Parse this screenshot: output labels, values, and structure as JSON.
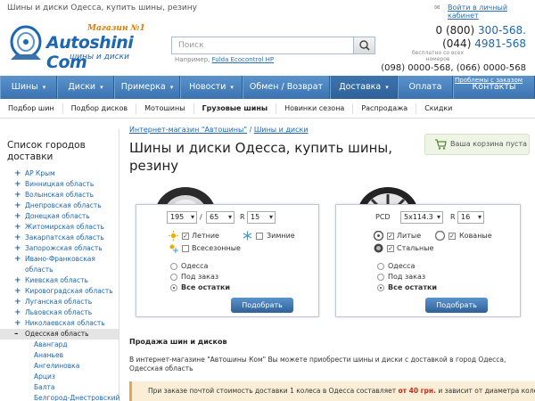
{
  "page": {
    "title": "Шины и диски Одесса, купить шины, резину",
    "login_link": "Войти в личный кабинет"
  },
  "header": {
    "logo_tag": "Магазин №1",
    "logo_name": "Autoshini Com",
    "logo_sub": "шины и диски",
    "search_placeholder": "Поиск",
    "search_hint_prefix": "Например,",
    "search_hint_example": "Fulda Ecocontrol HP",
    "phone1_prefix": "0 (800)",
    "phone1_number": "300-568.",
    "phone2_prefix": "(044)",
    "phone2_number": "4981-568",
    "free_note": "бесплатно со всех номеров",
    "phones_extra": "(098) 0000-568, (066) 0000-568"
  },
  "nav": {
    "items": [
      "Шины",
      "Диски",
      "Примерка",
      "Новости",
      "Обмен / Возврат",
      "Доставка",
      "Оплата",
      "Контакты"
    ],
    "problem_link": "Проблемы с заказом"
  },
  "subnav": {
    "items": [
      "Подбор шин",
      "Подбор дисков",
      "Мотошины",
      "Грузовые шины",
      "Новинки сезона",
      "Распродажа",
      "Скидки"
    ]
  },
  "sidebar": {
    "heading": "Список городов доставки",
    "regions": [
      "АР Крым",
      "Винницкая область",
      "Волынская область",
      "Днепровская область",
      "Донецкая область",
      "Житомирская область",
      "Закарпатская область",
      "Запорожская область",
      "Ивано-Франковская область",
      "Киевская область",
      "Кировоградская область",
      "Луганская область",
      "Львовская область",
      "Николаевская область",
      "Одесская область"
    ],
    "cities": [
      "Авангард",
      "Ананьев",
      "Ангелиновка",
      "Арциз",
      "Балта",
      "Белгород-Днестровский"
    ]
  },
  "content": {
    "breadcrumb_home": "Интернет-магазин \"Автошины\"",
    "breadcrumb_sep": "/",
    "breadcrumb_current": "Шины и диски",
    "heading": "Шины и диски Одесса, купить шины, резину",
    "cart_label": "Ваша корзина пуста",
    "section_title": "Продажа шин и дисков",
    "paragraph": "В интернет-магазине \"Автошины Ком\" Вы можете приобрести шины и диски с доставкой в город Одесса, Одесская область",
    "note_prefix": "При заказе почтой стоимость доставки 1 колеса в Одесса составляет",
    "note_price": "от 40 грн.",
    "note_suffix": "и зависит от диаметра колеса."
  },
  "tire_filter": {
    "width": "195",
    "sep": "/",
    "profile": "65",
    "r_label": "R",
    "radius": "15",
    "summer": "Летние",
    "winter": "Зимние",
    "allseason": "Всесезонные",
    "stock_odessa": "Одесса",
    "stock_order": "Под заказ",
    "stock_all": "Все остатки",
    "button": "Подобрать"
  },
  "rim_filter": {
    "pcd_label": "PCD",
    "pcd": "5x114.3",
    "r_label": "R",
    "radius": "16",
    "cast": "Литые",
    "forged": "Кованые",
    "steel": "Стальные",
    "stock_odessa": "Одесса",
    "stock_order": "Под заказ",
    "stock_all": "Все остатки",
    "button": "Подобрать"
  },
  "colors": {
    "nav_blue": "#3a73b0",
    "link_blue": "#1d66b0",
    "accent_orange": "#e07b00",
    "price_red": "#c8281c"
  }
}
